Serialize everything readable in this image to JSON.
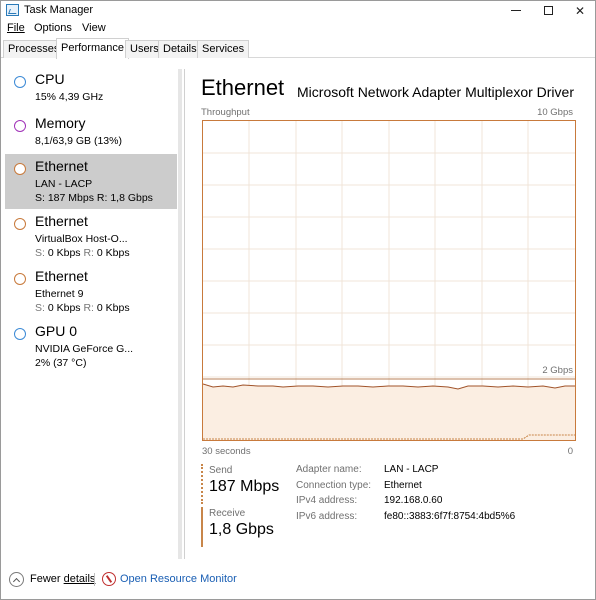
{
  "window": {
    "title": "Task Manager"
  },
  "menu": {
    "file": "File",
    "options": "Options",
    "view": "View"
  },
  "tabs": [
    {
      "label": "Processes",
      "active": false
    },
    {
      "label": "Performance",
      "active": true
    },
    {
      "label": "Users",
      "active": false
    },
    {
      "label": "Details",
      "active": false
    },
    {
      "label": "Services",
      "active": false
    }
  ],
  "sidebar": {
    "items": [
      {
        "title": "CPU",
        "line1": "15% 4,39 GHz",
        "color": "#3c8ad6",
        "selected": false
      },
      {
        "title": "Memory",
        "line1": "8,1/63,9 GB (13%)",
        "color": "#a032b8",
        "selected": false
      },
      {
        "title": "Ethernet",
        "line1": "LAN - LACP",
        "line2_s_label": "S:",
        "line2_s_value": "187 Mbps",
        "line2_r_label": "R:",
        "line2_r_value": "1,8 Gbps",
        "color": "#c87a3c",
        "selected": true
      },
      {
        "title": "Ethernet",
        "line1": "VirtualBox Host-O...",
        "line2_s_label": "S:",
        "line2_s_value": "0 Kbps",
        "line2_r_label": "R:",
        "line2_r_value": "0 Kbps",
        "color": "#c87a3c",
        "selected": false
      },
      {
        "title": "Ethernet",
        "line1": "Ethernet 9",
        "line2_s_label": "S:",
        "line2_s_value": "0 Kbps",
        "line2_r_label": "R:",
        "line2_r_value": "0 Kbps",
        "color": "#c87a3c",
        "selected": false
      },
      {
        "title": "GPU 0",
        "line1": "NVIDIA GeForce G...",
        "line2": "2% (37 °C)",
        "color": "#3c8ad6",
        "selected": false
      }
    ]
  },
  "main": {
    "title": "Ethernet",
    "adapter_name": "Microsoft Network Adapter Multiplexor Driver",
    "graph": {
      "label": "Throughput",
      "max_label": "10 Gbps",
      "scale_label": "2 Gbps",
      "time_left": "30 seconds",
      "time_right": "0"
    },
    "send": {
      "label": "Send",
      "value": "187 Mbps"
    },
    "receive": {
      "label": "Receive",
      "value": "1,8 Gbps"
    },
    "properties": [
      {
        "key": "Adapter name:",
        "value": "LAN - LACP"
      },
      {
        "key": "Connection type:",
        "value": "Ethernet"
      },
      {
        "key": "IPv4 address:",
        "value": "192.168.0.60"
      },
      {
        "key": "IPv6 address:",
        "value": "fe80::3883:6f7f:8754:4bd5%6"
      }
    ]
  },
  "footer": {
    "fewer_prefix": "Fewer ",
    "fewer_underlined": "details",
    "resource_monitor": "Open Resource Monitor"
  }
}
